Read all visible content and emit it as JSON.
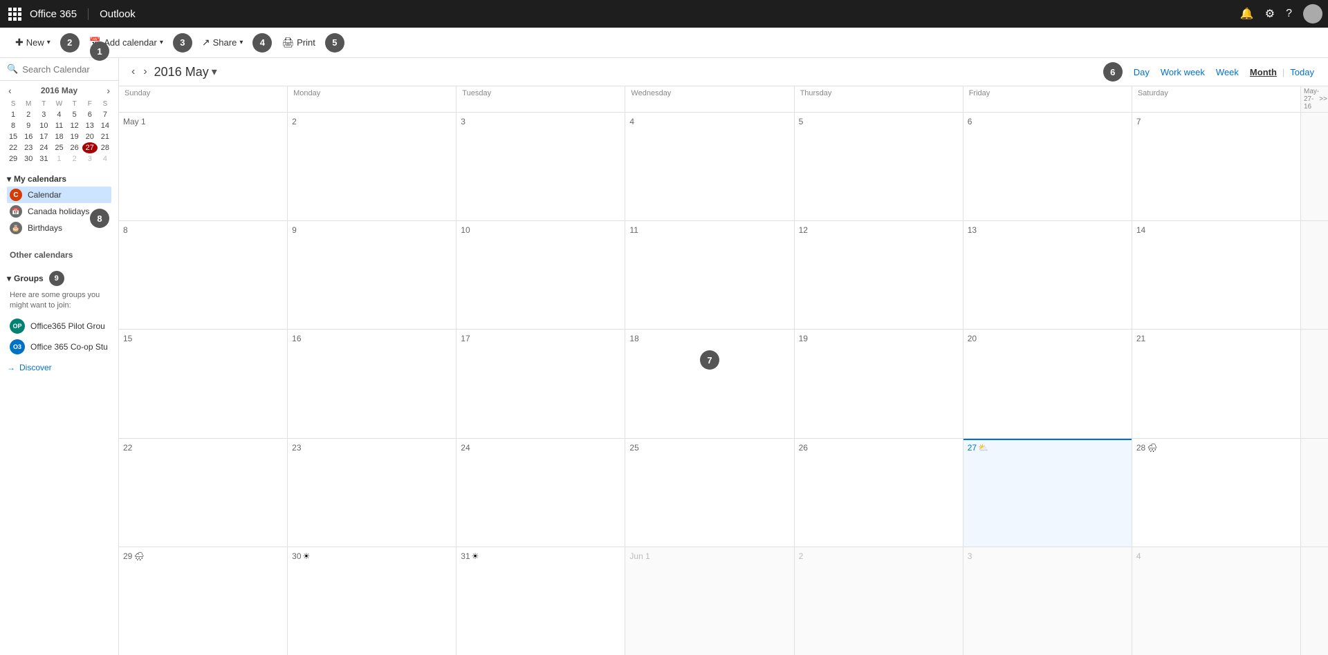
{
  "topbar": {
    "app_grid_label": "App launcher",
    "brand": "Office 365",
    "app_name": "Outlook",
    "bell_icon": "🔔",
    "settings_icon": "⚙",
    "help_icon": "?"
  },
  "toolbar": {
    "new_label": "New",
    "add_calendar_label": "Add calendar",
    "share_label": "Share",
    "print_label": "Print"
  },
  "search": {
    "placeholder": "Search Calendar"
  },
  "mini_cal": {
    "title": "2016 May",
    "days_of_week": [
      "S",
      "M",
      "T",
      "W",
      "T",
      "F",
      "S"
    ],
    "weeks": [
      [
        {
          "num": "1",
          "other": false
        },
        {
          "num": "2",
          "other": false
        },
        {
          "num": "3",
          "other": false
        },
        {
          "num": "4",
          "other": false
        },
        {
          "num": "5",
          "other": false
        },
        {
          "num": "6",
          "other": false
        },
        {
          "num": "7",
          "other": false
        }
      ],
      [
        {
          "num": "8",
          "other": false
        },
        {
          "num": "9",
          "other": false
        },
        {
          "num": "10",
          "other": false
        },
        {
          "num": "11",
          "other": false
        },
        {
          "num": "12",
          "other": false
        },
        {
          "num": "13",
          "other": false
        },
        {
          "num": "14",
          "other": false
        }
      ],
      [
        {
          "num": "15",
          "other": false
        },
        {
          "num": "16",
          "other": false
        },
        {
          "num": "17",
          "other": false
        },
        {
          "num": "18",
          "other": false
        },
        {
          "num": "19",
          "other": false
        },
        {
          "num": "20",
          "other": false
        },
        {
          "num": "21",
          "other": false
        }
      ],
      [
        {
          "num": "22",
          "other": false
        },
        {
          "num": "23",
          "other": false
        },
        {
          "num": "24",
          "other": false
        },
        {
          "num": "25",
          "other": false
        },
        {
          "num": "26",
          "other": false
        },
        {
          "num": "27",
          "today": true
        },
        {
          "num": "28",
          "other": false
        }
      ],
      [
        {
          "num": "29",
          "other": false
        },
        {
          "num": "30",
          "other": false
        },
        {
          "num": "31",
          "other": false
        },
        {
          "num": "1",
          "other": true
        },
        {
          "num": "2",
          "other": true
        },
        {
          "num": "3",
          "other": true
        },
        {
          "num": "4",
          "other": true
        }
      ]
    ]
  },
  "my_calendars": {
    "label": "My calendars",
    "items": [
      {
        "name": "Calendar",
        "color": "#d83b01",
        "initial": "C",
        "active": true
      },
      {
        "name": "Canada holidays",
        "color": "#6c6c6c",
        "initial": "",
        "icon": "📅"
      },
      {
        "name": "Birthdays",
        "color": "#6c6c6c",
        "initial": "",
        "icon": "🎂"
      }
    ]
  },
  "other_calendars": {
    "label": "Other calendars"
  },
  "groups": {
    "label": "Groups",
    "hint": "Here are some groups you might want to join:",
    "items": [
      {
        "name": "Office365 Pilot Grou",
        "color": "#008272",
        "initials": "OP"
      },
      {
        "name": "Office 365 Co-op Stu",
        "color": "#0072c6",
        "initials": "O3"
      }
    ],
    "discover_label": "Discover"
  },
  "cal_header": {
    "month_year": "2016 May",
    "views": [
      "Day",
      "Work week",
      "Week",
      "Month",
      "Today"
    ]
  },
  "cal_grid": {
    "col_headers": [
      "Sunday",
      "Monday",
      "Tuesday",
      "Wednesday",
      "Thursday",
      "Friday",
      "Saturday"
    ],
    "right_panel_label": "May-27-16",
    "weeks": [
      {
        "cells": [
          {
            "num": "May 1",
            "weather": "",
            "today": false,
            "other": false
          },
          {
            "num": "2",
            "weather": "",
            "today": false,
            "other": false
          },
          {
            "num": "3",
            "weather": "",
            "today": false,
            "other": false
          },
          {
            "num": "4",
            "weather": "",
            "today": false,
            "other": false
          },
          {
            "num": "5",
            "weather": "",
            "today": false,
            "other": false
          },
          {
            "num": "6",
            "weather": "",
            "today": false,
            "other": false
          },
          {
            "num": "7",
            "weather": "",
            "today": false,
            "other": false
          }
        ]
      },
      {
        "cells": [
          {
            "num": "8",
            "weather": "",
            "today": false,
            "other": false
          },
          {
            "num": "9",
            "weather": "",
            "today": false,
            "other": false
          },
          {
            "num": "10",
            "weather": "",
            "today": false,
            "other": false
          },
          {
            "num": "11",
            "weather": "",
            "today": false,
            "other": false
          },
          {
            "num": "12",
            "weather": "",
            "today": false,
            "other": false
          },
          {
            "num": "13",
            "weather": "",
            "today": false,
            "other": false
          },
          {
            "num": "14",
            "weather": "",
            "today": false,
            "other": false
          }
        ]
      },
      {
        "cells": [
          {
            "num": "15",
            "weather": "",
            "today": false,
            "other": false
          },
          {
            "num": "16",
            "weather": "",
            "today": false,
            "other": false
          },
          {
            "num": "17",
            "weather": "",
            "today": false,
            "other": false
          },
          {
            "num": "18",
            "weather": "",
            "today": false,
            "other": false
          },
          {
            "num": "19",
            "weather": "",
            "today": false,
            "other": false
          },
          {
            "num": "20",
            "weather": "",
            "today": false,
            "other": false
          },
          {
            "num": "21",
            "weather": "",
            "today": false,
            "other": false
          }
        ]
      },
      {
        "cells": [
          {
            "num": "22",
            "weather": "",
            "today": false,
            "other": false
          },
          {
            "num": "23",
            "weather": "",
            "today": false,
            "other": false
          },
          {
            "num": "24",
            "weather": "",
            "today": false,
            "other": false
          },
          {
            "num": "25",
            "weather": "",
            "today": false,
            "other": false
          },
          {
            "num": "26",
            "weather": "",
            "today": false,
            "other": false
          },
          {
            "num": "27",
            "weather": "⛅",
            "today": true,
            "other": false
          },
          {
            "num": "28",
            "weather": "🌧",
            "today": false,
            "other": false
          }
        ]
      },
      {
        "cells": [
          {
            "num": "29",
            "weather": "🌧",
            "today": false,
            "other": false
          },
          {
            "num": "30",
            "weather": "☀",
            "today": false,
            "other": false
          },
          {
            "num": "31",
            "weather": "☀",
            "today": false,
            "other": false
          },
          {
            "num": "Jun 1",
            "weather": "",
            "today": false,
            "other": true
          },
          {
            "num": "2",
            "weather": "",
            "today": false,
            "other": true
          },
          {
            "num": "3",
            "weather": "",
            "today": false,
            "other": true
          },
          {
            "num": "4",
            "weather": "",
            "today": false,
            "other": true
          }
        ]
      }
    ]
  }
}
